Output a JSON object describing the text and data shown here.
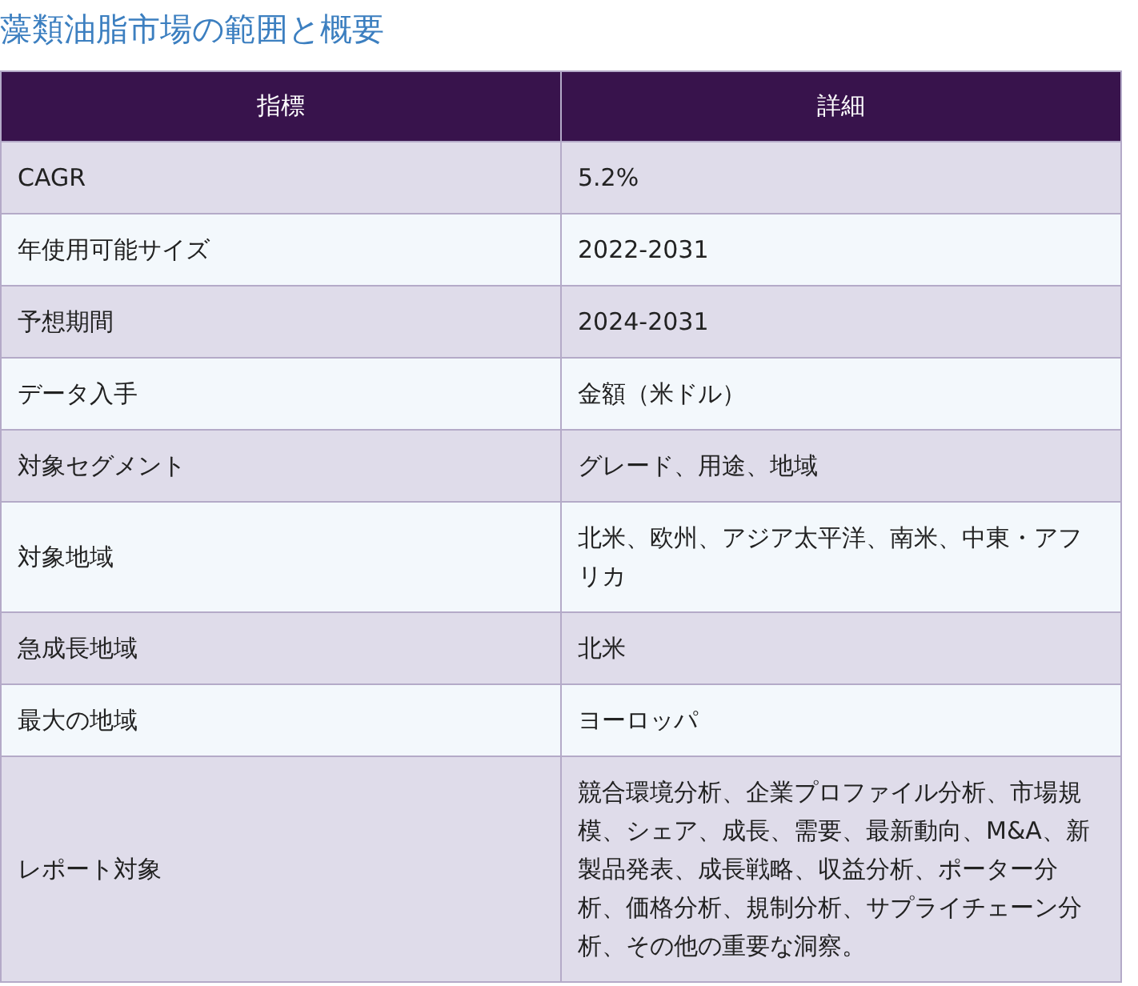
{
  "title": "藻類油脂市場の範囲と概要",
  "table": {
    "columns": [
      "指標",
      "詳細"
    ],
    "rows": [
      {
        "metric": "CAGR",
        "detail": "5.2%"
      },
      {
        "metric": "年使用可能サイズ",
        "detail": "2022-2031"
      },
      {
        "metric": "予想期間",
        "detail": "2024-2031"
      },
      {
        "metric": "データ入手",
        "detail": "金額（米ドル）"
      },
      {
        "metric": "対象セグメント",
        "detail": "グレード、用途、地域"
      },
      {
        "metric": "対象地域",
        "detail": "北米、欧州、アジア太平洋、南米、中東・アフリカ"
      },
      {
        "metric": "急成長地域",
        "detail": "北米"
      },
      {
        "metric": "最大の地域",
        "detail": "ヨーロッパ"
      },
      {
        "metric": "レポート対象",
        "detail": "競合環境分析、企業プロファイル分析、市場規模、シェア、成長、需要、最新動向、M&A、新製品発表、成長戦略、収益分析、ポーター分析、価格分析、規制分析、サプライチェーン分析、その他の重要な洞察。"
      }
    ]
  }
}
